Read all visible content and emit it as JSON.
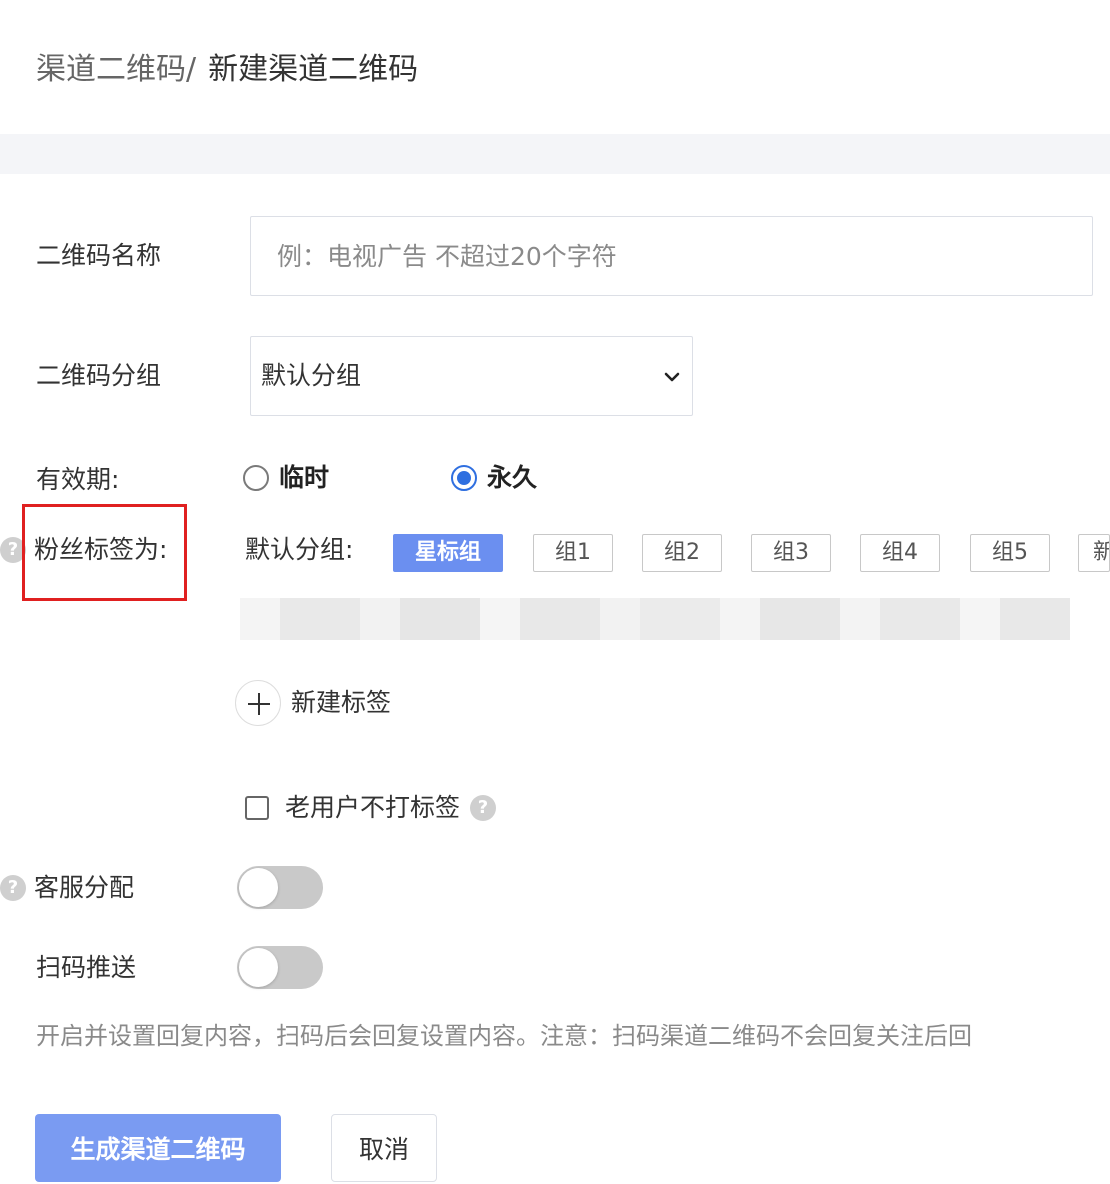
{
  "breadcrumb": {
    "parent": "渠道二维码",
    "separator": "/",
    "current": "新建渠道二维码"
  },
  "form": {
    "name": {
      "label": "二维码名称",
      "placeholder": "例：电视广告 不超过20个字符",
      "value": ""
    },
    "group": {
      "label": "二维码分组",
      "selected": "默认分组"
    },
    "validity": {
      "label": "有效期:",
      "options": [
        "临时",
        "永久"
      ],
      "selected": "永久"
    },
    "fan_tags": {
      "label": "粉丝标签为:",
      "group_label": "默认分组:",
      "tags": [
        "星标组",
        "组1",
        "组2",
        "组3",
        "组4",
        "组5",
        "新"
      ],
      "selected_tag": "星标组",
      "add_tag_label": "新建标签",
      "old_user_label": "老用户不打标签",
      "old_user_checked": false
    },
    "service_assign": {
      "label": "客服分配",
      "enabled": false
    },
    "scan_push": {
      "label": "扫码推送",
      "enabled": false
    },
    "notice": "开启并设置回复内容，扫码后会回复设置内容。注意：扫码渠道二维码不会回复关注后回"
  },
  "buttons": {
    "submit": "生成渠道二维码",
    "cancel": "取消"
  },
  "icons": {
    "help": "question-circle-icon",
    "select_arrow": "chevron-down-icon",
    "add": "plus-circle-icon"
  },
  "colors": {
    "accent": "#2f6fe0",
    "selected_tag_bg": "#6b8ff0",
    "primary_button": "#7a9bf2",
    "highlight_box": "#e02020",
    "toggle_off": "#c9c9c9"
  }
}
